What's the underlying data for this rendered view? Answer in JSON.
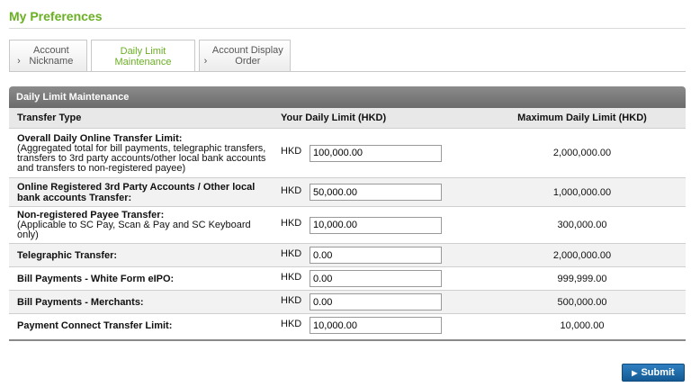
{
  "page_title": "My Preferences",
  "tabs": [
    {
      "label": "Account Nickname",
      "prefix": "›",
      "active": false
    },
    {
      "label": "Daily Limit Maintenance",
      "prefix": "",
      "active": true
    },
    {
      "label": "Account Display Order",
      "prefix": "›",
      "active": false
    }
  ],
  "panel_title": "Daily Limit Maintenance",
  "columns": [
    "Transfer Type",
    "Your Daily Limit (HKD)",
    "Maximum Daily Limit (HKD)"
  ],
  "rows": [
    {
      "label": "Overall Daily Online Transfer Limit:",
      "note": "(Aggregated total for bill payments, telegraphic transfers, transfers to 3rd party accounts/other local bank accounts and transfers to non-registered payee)",
      "currency": "HKD",
      "value": "100,000.00",
      "max": "2,000,000.00"
    },
    {
      "label": "Online Registered 3rd Party Accounts / Other local bank accounts Transfer:",
      "note": "",
      "currency": "HKD",
      "value": "50,000.00",
      "max": "1,000,000.00"
    },
    {
      "label": "Non-registered Payee Transfer:",
      "note": "(Applicable to SC Pay, Scan & Pay and SC Keyboard only)",
      "currency": "HKD",
      "value": "10,000.00",
      "max": "300,000.00"
    },
    {
      "label": "Telegraphic Transfer:",
      "note": "",
      "currency": "HKD",
      "value": "0.00",
      "max": "2,000,000.00"
    },
    {
      "label": "Bill Payments - White Form eIPO:",
      "note": "",
      "currency": "HKD",
      "value": "0.00",
      "max": "999,999.00"
    },
    {
      "label": "Bill Payments - Merchants:",
      "note": "",
      "currency": "HKD",
      "value": "0.00",
      "max": "500,000.00"
    },
    {
      "label": "Payment Connect Transfer Limit:",
      "note": "",
      "currency": "HKD",
      "value": "10,000.00",
      "max": "10,000.00"
    }
  ],
  "submit_label": "Submit",
  "colors": {
    "accent_green": "#6ab023",
    "header_gray": "#7b7b7b",
    "button_blue": "#1f6aa8"
  }
}
